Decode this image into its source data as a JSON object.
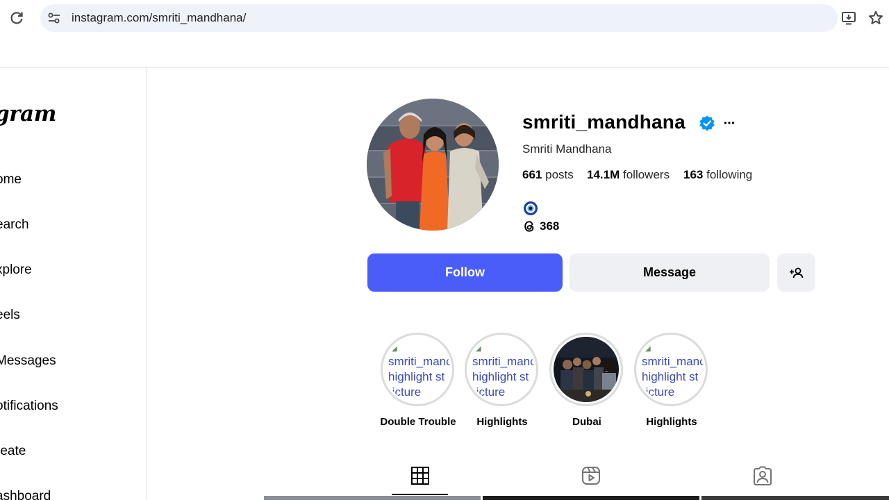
{
  "browser": {
    "url": "instagram.com/smriti_mandhana/",
    "icons": {
      "reload": "reload-icon",
      "site_info": "site-settings-icon",
      "install": "install-app-icon",
      "bookmark": "star-icon"
    }
  },
  "sidebar": {
    "logo": "gram",
    "items": [
      {
        "label": "ome",
        "icon": "home-icon"
      },
      {
        "label": "earch",
        "icon": "search-icon"
      },
      {
        "label": "xplore",
        "icon": "explore-icon"
      },
      {
        "label": "eels",
        "icon": "reels-icon"
      },
      {
        "label": "Messages",
        "icon": "messages-icon"
      },
      {
        "label": "otifications",
        "icon": "heart-icon"
      },
      {
        "label": "reate",
        "icon": "create-icon"
      },
      {
        "label": "ashboard",
        "icon": "dashboard-icon"
      }
    ]
  },
  "profile": {
    "username": "smriti_mandhana",
    "full_name": "Smriti Mandhana",
    "stats": {
      "posts_value": "661",
      "posts_label": "posts",
      "followers_value": "14.1M",
      "followers_label": "followers",
      "following_value": "163",
      "following_label": "following"
    },
    "threads_count": "368",
    "colors": {
      "verified": "#0095f6",
      "follow": "#4a5df9"
    }
  },
  "actions": {
    "follow_label": "Follow",
    "message_label": "Message"
  },
  "highlights": [
    {
      "label": "Double Trouble",
      "alt_text": "smriti_mandhana's highlight story picture",
      "alt_visible": "smriti_manc\nhighlight st\n·icture",
      "loaded": false
    },
    {
      "label": "Highlights",
      "alt_text": "smriti_mandhana's highlight story picture",
      "alt_visible": "smriti_manc\nhighlight st\n·icture",
      "loaded": false
    },
    {
      "label": "Dubai",
      "alt_text": "",
      "alt_visible": "",
      "loaded": true
    },
    {
      "label": "Highlights",
      "alt_text": "smriti_mandhana's highlight story picture",
      "alt_visible": "smriti_manc\nhighlight st\n·icture",
      "loaded": false
    }
  ],
  "tabs": [
    {
      "icon": "grid-icon",
      "active": true
    },
    {
      "icon": "reels-icon",
      "active": false
    },
    {
      "icon": "tagged-icon",
      "active": false
    }
  ]
}
